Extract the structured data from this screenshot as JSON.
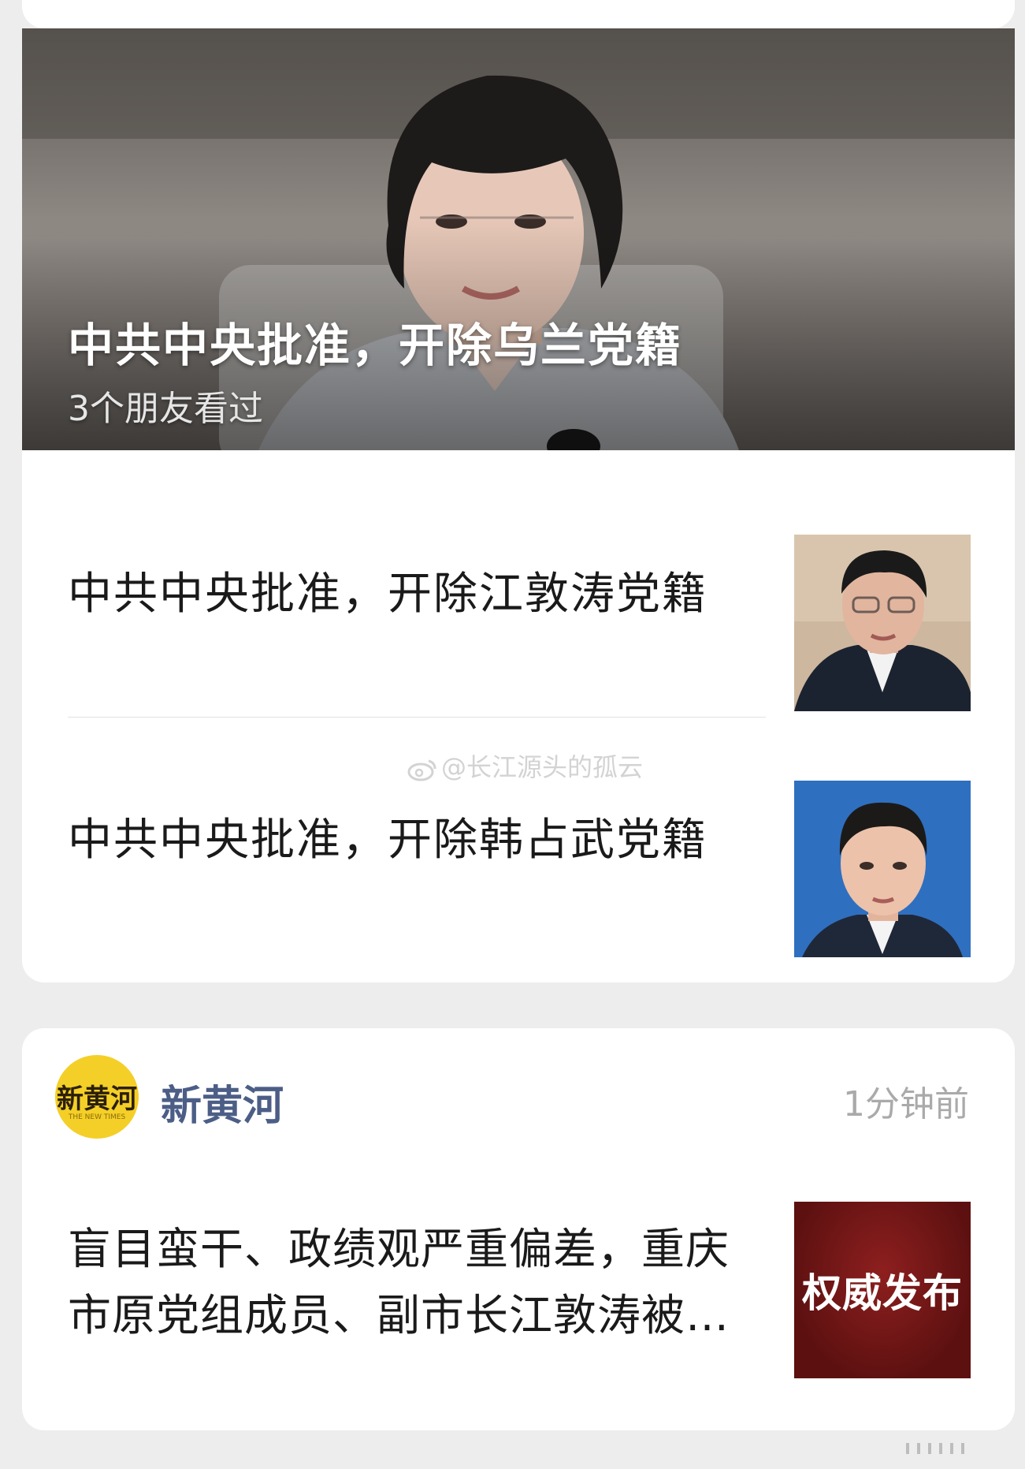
{
  "feed": {
    "hero": {
      "title": "中共中央批准，开除乌兰党籍",
      "subtitle": "3个朋友看过",
      "image_icon": "portrait-photo"
    },
    "items": [
      {
        "title": "中共中央批准，开除江敦涛党籍",
        "thumb_icon": "portrait-photo"
      },
      {
        "title": "中共中央批准，开除韩占武党籍",
        "thumb_icon": "portrait-photo"
      }
    ],
    "watermark": "@长江源头的孤云"
  },
  "post": {
    "source_name": "新黄河",
    "source_logo_text": "新黄河",
    "source_logo_sub": "THE NEW TIMES",
    "time": "1分钟前",
    "title_lines": [
      "盲目蛮干、政绩观严重偏差，重庆",
      "市原党组成员、副市长江敦涛被…"
    ],
    "thumb_text": "权威发布"
  },
  "colors": {
    "background": "#ededed",
    "card": "#ffffff",
    "source_name": "#4c5e86",
    "time": "#aaaaaa",
    "thumb_red": "#7a1515"
  }
}
